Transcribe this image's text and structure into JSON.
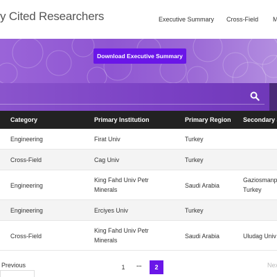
{
  "header": {
    "site_title": "y Cited Researchers",
    "nav": {
      "executive_summary": "Executive Summary",
      "cross_field": "Cross-Field",
      "more": "M"
    }
  },
  "hero": {
    "download_label": "Download Executive Summary"
  },
  "search": {
    "icon": "search-icon"
  },
  "table": {
    "columns": [
      "Category",
      "Primary Institution",
      "Primary Region",
      "Secondary a"
    ],
    "rows": [
      {
        "category": "Engineering",
        "institution": "Firat Univ",
        "region": "Turkey",
        "secondary": ""
      },
      {
        "category": "Cross-Field",
        "institution": "Cag Univ",
        "region": "Turkey",
        "secondary": ""
      },
      {
        "category": "Engineering",
        "institution": "King Fahd Univ Petr Minerals",
        "region": "Saudi Arabia",
        "secondary": "Gaziosmanp Turkey"
      },
      {
        "category": "Engineering",
        "institution": "Erciyes Univ",
        "region": "Turkey",
        "secondary": ""
      },
      {
        "category": "Cross-Field",
        "institution": "King Fahd Univ Petr Minerals",
        "region": "Saudi Arabia",
        "secondary": "Uludag Univ"
      }
    ]
  },
  "pagination": {
    "previous": "Previous",
    "page_1": "1",
    "ellipsis": "...",
    "page_2": "2",
    "next": "Next"
  },
  "colors": {
    "accent": "#6a16e8",
    "header_bg": "#222222"
  }
}
